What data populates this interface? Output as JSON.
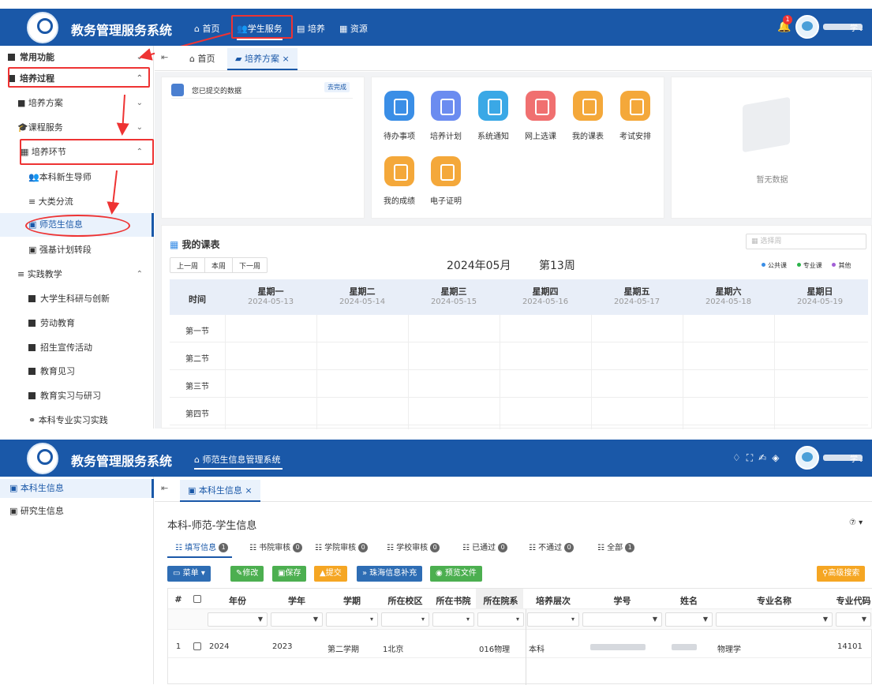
{
  "app_title": "教务管理服务系统",
  "top": {
    "nav": [
      "首页",
      "学生服务",
      "培养",
      "资源"
    ],
    "notify_count": "1",
    "user_suffix": "学"
  },
  "sidebar": {
    "items": [
      "常用功能",
      "培养过程",
      "培养方案",
      "课程服务",
      "培养环节",
      "本科新生导师",
      "大类分流",
      "师范生信息",
      "强基计划转段",
      "实践教学",
      "大学生科研与创新",
      "劳动教育",
      "招生宣传活动",
      "教育见习",
      "教育实习与研习",
      "本科专业实习实践"
    ]
  },
  "tabs": {
    "home": "首页",
    "active": "培养方案"
  },
  "pending": {
    "label": "您已提交的数据",
    "status": "去完成"
  },
  "quick": [
    "待办事项",
    "培养计划",
    "系统通知",
    "网上选课",
    "我的课表",
    "考试安排",
    "我的成绩",
    "电子证明"
  ],
  "empty_text": "暂无数据",
  "schedule": {
    "title": "我的课表",
    "week_picker_placeholder": "选择周",
    "buttons": [
      "上一周",
      "本周",
      "下一周"
    ],
    "month": "2024年05月",
    "week": "第13周",
    "legend": [
      "公共课",
      "专业课",
      "其他"
    ],
    "legend_colors": [
      "#3a8ee6",
      "#2bb34a",
      "#a25fd6"
    ],
    "time_header": "时间",
    "days": [
      {
        "name": "星期一",
        "date": "2024-05-13"
      },
      {
        "name": "星期二",
        "date": "2024-05-14"
      },
      {
        "name": "星期三",
        "date": "2024-05-15"
      },
      {
        "name": "星期四",
        "date": "2024-05-16"
      },
      {
        "name": "星期五",
        "date": "2024-05-17"
      },
      {
        "name": "星期六",
        "date": "2024-05-18"
      },
      {
        "name": "星期日",
        "date": "2024-05-19"
      }
    ],
    "periods": [
      "第一节",
      "第二节",
      "第三节",
      "第四节"
    ]
  },
  "bottom": {
    "header_nav": "师范生信息管理系统",
    "sidebar": [
      "本科生信息",
      "研究生信息"
    ],
    "tab": "本科生信息",
    "page_title": "本科-师范-学生信息",
    "help": "⑦",
    "status_tabs": [
      {
        "label": "填写信息",
        "count": "1"
      },
      {
        "label": "书院审核",
        "count": "0"
      },
      {
        "label": "学院审核",
        "count": "0"
      },
      {
        "label": "学校审核",
        "count": "0"
      },
      {
        "label": "已通过",
        "count": "0"
      },
      {
        "label": "不通过",
        "count": "0"
      },
      {
        "label": "全部",
        "count": "1"
      }
    ],
    "toolbar": {
      "menu": "菜单",
      "edit": "修改",
      "save": "保存",
      "submit": "提交",
      "supplement": "珠海信息补充",
      "preview": "预览文件",
      "advanced_search": "高级搜索"
    },
    "columns": [
      "#",
      "年份",
      "学年",
      "学期",
      "所在校区",
      "所在书院",
      "所在院系",
      "培养层次",
      "学号",
      "姓名",
      "专业名称",
      "专业代码"
    ],
    "row": {
      "index": "1",
      "year": "2024",
      "school_year": "2023",
      "term": "第二学期",
      "campus": "1北京",
      "college": "",
      "department": "016物理",
      "level": "本科",
      "major": "物理学",
      "major_code": "14101"
    }
  }
}
